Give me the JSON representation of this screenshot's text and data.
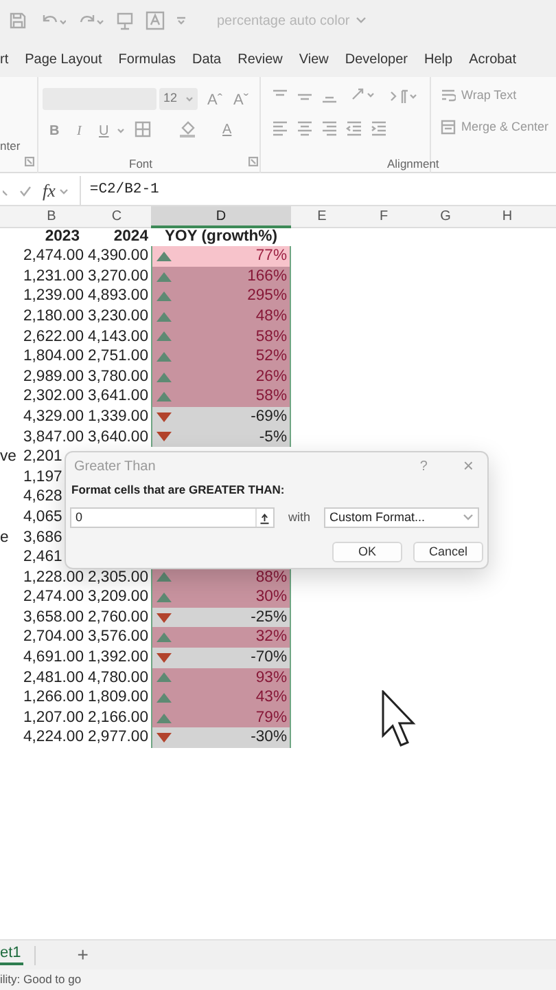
{
  "title_bar": {
    "title": "percentage auto color"
  },
  "ribbon_tabs": [
    {
      "label": "rt"
    },
    {
      "label": "Page Layout"
    },
    {
      "label": "Formulas"
    },
    {
      "label": "Data"
    },
    {
      "label": "Review"
    },
    {
      "label": "View"
    },
    {
      "label": "Developer"
    },
    {
      "label": "Help"
    },
    {
      "label": "Acrobat"
    }
  ],
  "ribbon": {
    "left_group_label": "nter",
    "font_size": "12",
    "grow_font": "Aˆ",
    "shrink_font": "Aˇ",
    "style_buttons": [
      "B",
      "I",
      "U"
    ],
    "font_color": "A",
    "font_group_label": "Font",
    "wrap_text": "Wrap Text",
    "merge_center": "Merge & Center",
    "alignment_group_label": "Alignment"
  },
  "formula_bar": {
    "fx": "fx",
    "formula": "=C2/B2-1"
  },
  "columns": [
    {
      "label": "B",
      "selected": false
    },
    {
      "label": "C",
      "selected": false
    },
    {
      "label": "D",
      "selected": true
    },
    {
      "label": "E",
      "selected": false
    },
    {
      "label": "F",
      "selected": false
    },
    {
      "label": "G",
      "selected": false
    },
    {
      "label": "H",
      "selected": false
    }
  ],
  "header_row": {
    "b": "2023",
    "c": "2024",
    "d": "YOY (growth%)"
  },
  "rows": [
    {
      "b": "2,474.00",
      "c": "4,390.00",
      "d": "77%",
      "kind": "up",
      "active": true
    },
    {
      "b": "1,231.00",
      "c": "3,270.00",
      "d": "166%",
      "kind": "up",
      "active": false
    },
    {
      "b": "1,239.00",
      "c": "4,893.00",
      "d": "295%",
      "kind": "up",
      "active": false
    },
    {
      "b": "2,180.00",
      "c": "3,230.00",
      "d": "48%",
      "kind": "up",
      "active": false
    },
    {
      "b": "2,622.00",
      "c": "4,143.00",
      "d": "58%",
      "kind": "up",
      "active": false
    },
    {
      "b": "1,804.00",
      "c": "2,751.00",
      "d": "52%",
      "kind": "up",
      "active": false
    },
    {
      "b": "2,989.00",
      "c": "3,780.00",
      "d": "26%",
      "kind": "up",
      "active": false
    },
    {
      "b": "2,302.00",
      "c": "3,641.00",
      "d": "58%",
      "kind": "up",
      "active": false
    },
    {
      "b": "4,329.00",
      "c": "1,339.00",
      "d": "-69%",
      "kind": "down",
      "active": false
    },
    {
      "b": "3,847.00",
      "c": "3,640.00",
      "d": "-5%",
      "kind": "down",
      "active": false
    },
    {
      "a": "ve",
      "b": "2,201"
    },
    {
      "b": "1,197"
    },
    {
      "b": "4,628"
    },
    {
      "b": "4,065"
    },
    {
      "a": "e",
      "b": "3,686"
    },
    {
      "b": "2,461"
    },
    {
      "b": "1,228.00",
      "c": "2,305.00",
      "d": "88%",
      "kind": "up",
      "active": false
    },
    {
      "b": "2,474.00",
      "c": "3,209.00",
      "d": "30%",
      "kind": "up",
      "active": false
    },
    {
      "b": "3,658.00",
      "c": "2,760.00",
      "d": "-25%",
      "kind": "down",
      "active": false
    },
    {
      "b": "2,704.00",
      "c": "3,576.00",
      "d": "32%",
      "kind": "up",
      "active": false
    },
    {
      "b": "4,691.00",
      "c": "1,392.00",
      "d": "-70%",
      "kind": "down",
      "active": false
    },
    {
      "b": "2,481.00",
      "c": "4,780.00",
      "d": "93%",
      "kind": "up",
      "active": false
    },
    {
      "b": "1,266.00",
      "c": "1,809.00",
      "d": "43%",
      "kind": "up",
      "active": false
    },
    {
      "b": "1,207.00",
      "c": "2,166.00",
      "d": "79%",
      "kind": "up",
      "active": false
    },
    {
      "b": "4,224.00",
      "c": "2,977.00",
      "d": "-30%",
      "kind": "down",
      "active": false
    }
  ],
  "dialog": {
    "title": "Greater Than",
    "help": "?",
    "close": "×",
    "prompt": "Format cells that are GREATER THAN:",
    "value": "0",
    "with_label": "with",
    "format": "Custom Format...",
    "ok": "OK",
    "cancel": "Cancel"
  },
  "sheet_tabs": [
    {
      "label": "et1",
      "selected": true
    }
  ],
  "add_sheet": "+",
  "status": "ility: Good to go"
}
